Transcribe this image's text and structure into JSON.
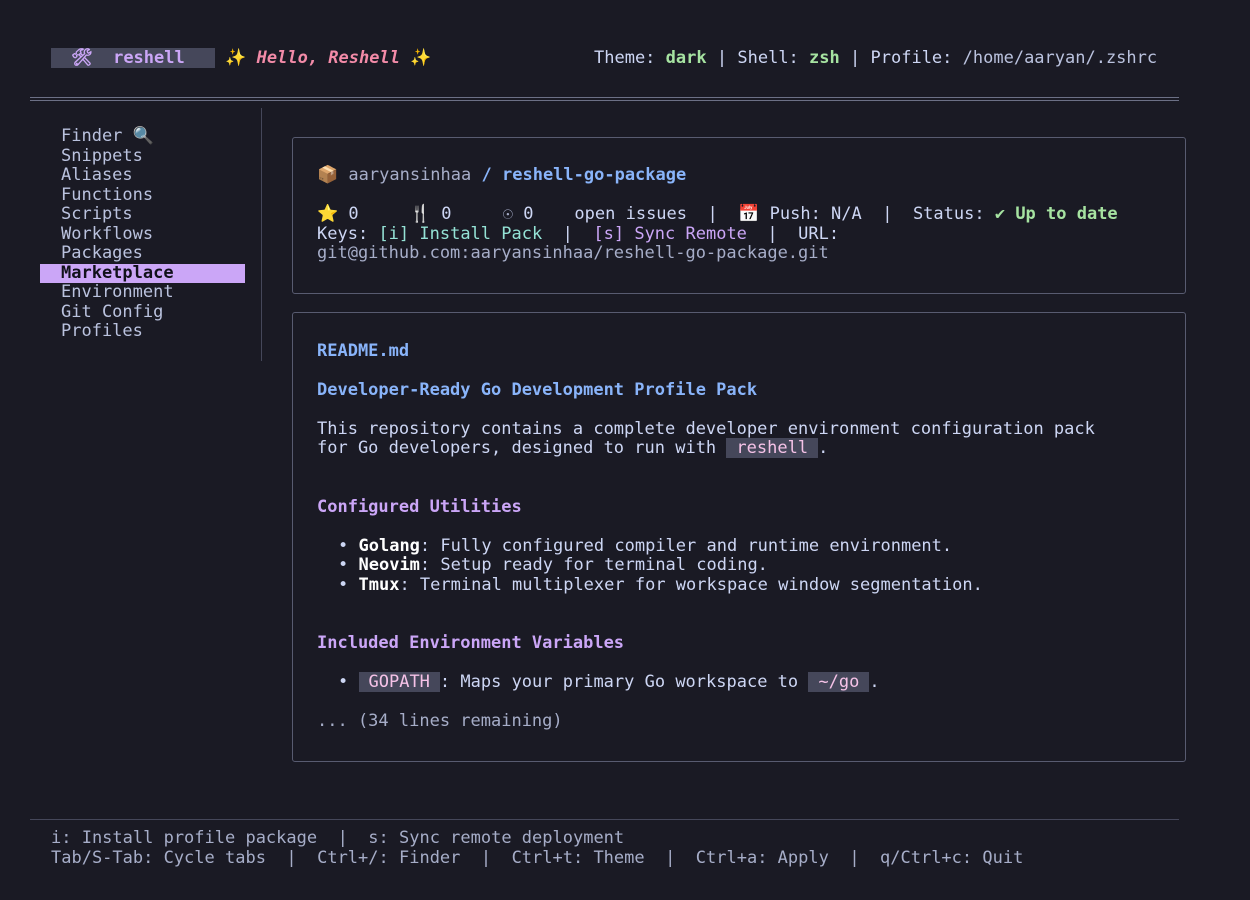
{
  "header": {
    "app_icon": "🛠",
    "app_name": "reshell",
    "sparkle": "✨",
    "greeting": "Hello, Reshell",
    "theme_label": "Theme:",
    "theme_value": "dark",
    "shell_label": "Shell:",
    "shell_value": "zsh",
    "profile_label": "Profile:",
    "profile_value": "/home/aaryan/.zshrc",
    "sep": "|"
  },
  "sidebar": {
    "items": [
      {
        "label": "Finder 🔍"
      },
      {
        "label": "Snippets"
      },
      {
        "label": "Aliases"
      },
      {
        "label": "Functions"
      },
      {
        "label": "Scripts"
      },
      {
        "label": "Workflows"
      },
      {
        "label": "Packages"
      },
      {
        "label": "Marketplace"
      },
      {
        "label": "Environment"
      },
      {
        "label": "Git Config"
      },
      {
        "label": "Profiles"
      }
    ],
    "active_index": 7
  },
  "repo": {
    "icon": "📦",
    "owner": "aaryansinhaa",
    "slash": "/",
    "name": "reshell-go-package",
    "stars_icon": "⭐",
    "stars": "0",
    "forks_icon": "🍴",
    "forks": "0",
    "issues_icon": "☉",
    "issues": "0",
    "issues_label": "open issues",
    "push_icon": "📅",
    "push_label": "Push: N/A",
    "status_label": "Status:",
    "status_value": "✔ Up to date",
    "keys_label": "Keys:",
    "key_install": "[i] Install Pack",
    "key_sync": "[s] Sync Remote",
    "url_label": "URL:",
    "url": "git@github.com:aaryansinhaa/reshell-go-package.git"
  },
  "readme": {
    "filename": "README.md",
    "title": "Developer-Ready Go Development Profile Pack",
    "intro_1": "This repository contains a complete developer environment configuration pack",
    "intro_2": "for Go developers, designed to run with",
    "intro_code": "reshell",
    "intro_end": ".",
    "section_utilities": "Configured Utilities",
    "utilities": [
      {
        "name": "Golang",
        "desc": ": Fully configured compiler and runtime environment."
      },
      {
        "name": "Neovim",
        "desc": ": Setup ready for terminal coding."
      },
      {
        "name": "Tmux",
        "desc": ": Terminal multiplexer for workspace window segmentation."
      }
    ],
    "section_env": "Included Environment Variables",
    "env_var": "GOPATH",
    "env_desc": ": Maps your primary Go workspace to",
    "env_value": "~/go",
    "env_end": ".",
    "bullet": "•",
    "remaining": "... (34 lines remaining)"
  },
  "footer": {
    "line1": "i: Install profile package  |  s: Sync remote deployment",
    "line2": "Tab/S-Tab: Cycle tabs  |  Ctrl+/: Finder  |  Ctrl+t: Theme  |  Ctrl+a: Apply  |  q/Ctrl+c: Quit"
  },
  "colors": {
    "background": "#1a1a24",
    "accent": "#cba6f7",
    "blue": "#89b4fa",
    "green": "#a6e3a1"
  }
}
